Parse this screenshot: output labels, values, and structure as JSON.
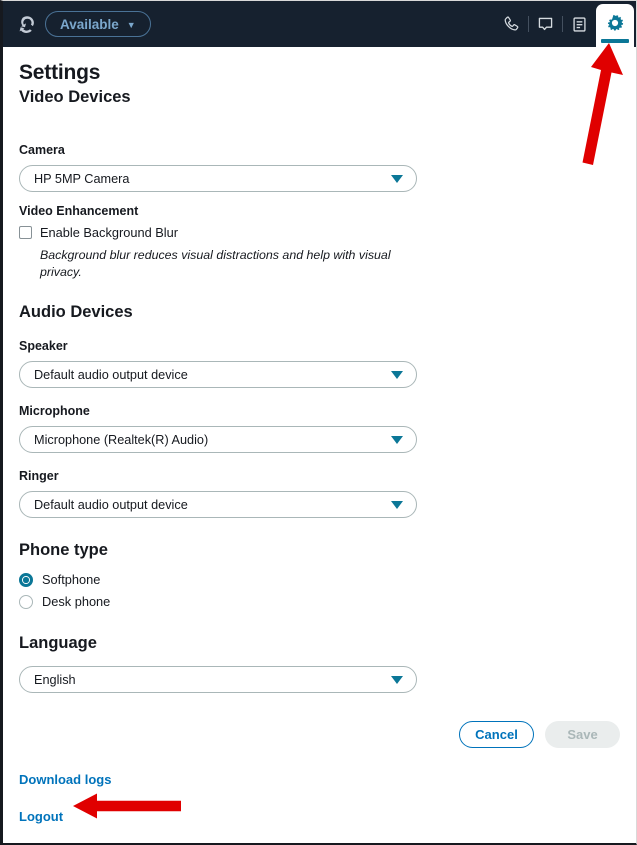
{
  "header": {
    "logo_icon": "connect-cloud-logo-icon",
    "status": {
      "label": "Available",
      "caret": "▼"
    },
    "icons": [
      {
        "name": "phone-icon",
        "glyph": "phone"
      },
      {
        "name": "chat-icon",
        "glyph": "chat"
      },
      {
        "name": "tasks-icon",
        "glyph": "tasks"
      },
      {
        "name": "settings-gear-icon",
        "glyph": "gear",
        "active": true
      }
    ]
  },
  "page": {
    "title": "Settings",
    "subtitle": "Video Devices"
  },
  "video": {
    "camera_label": "Camera",
    "camera_value": "HP 5MP Camera",
    "enhancement_label": "Video Enhancement",
    "blur_checkbox_label": "Enable Background Blur",
    "blur_checked": false,
    "blur_helper": "Background blur reduces visual distractions and help with visual privacy."
  },
  "audio": {
    "heading": "Audio Devices",
    "speaker_label": "Speaker",
    "speaker_value": "Default audio output device",
    "microphone_label": "Microphone",
    "microphone_value": "Microphone (Realtek(R) Audio)",
    "ringer_label": "Ringer",
    "ringer_value": "Default audio output device"
  },
  "phone_type": {
    "heading": "Phone type",
    "options": [
      {
        "label": "Softphone",
        "selected": true
      },
      {
        "label": "Desk phone",
        "selected": false
      }
    ]
  },
  "language": {
    "heading": "Language",
    "value": "English"
  },
  "actions": {
    "cancel_label": "Cancel",
    "save_label": "Save",
    "save_disabled": true
  },
  "links": {
    "download_logs": "Download logs",
    "logout": "Logout"
  },
  "annotations": {
    "color": "#e00000",
    "arrows": [
      {
        "name": "arrow-pointing-to-settings-gear",
        "direction": "up"
      },
      {
        "name": "arrow-pointing-to-logout",
        "direction": "left"
      }
    ]
  },
  "colors": {
    "header_bg": "#16212f",
    "accent_teal": "#0b7797",
    "link_blue": "#0073bb",
    "text": "#16191f",
    "border": "#aab7b8",
    "annotation_red": "#e00000"
  }
}
